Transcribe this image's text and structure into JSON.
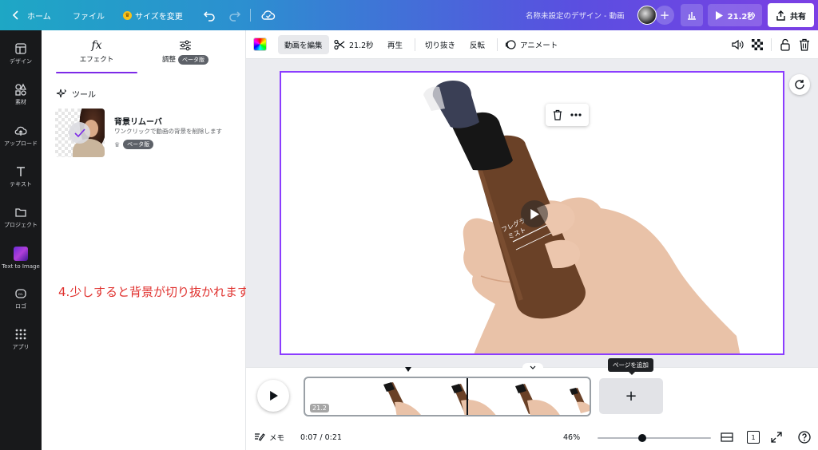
{
  "topbar": {
    "home_label": "ホーム",
    "file_label": "ファイル",
    "resize_label": "サイズを変更",
    "doc_title": "名称未設定のデザイン - 動画",
    "play_duration": "21.2秒",
    "share_label": "共有"
  },
  "rail": {
    "items": [
      {
        "label": "デザイン",
        "icon": "layout-icon"
      },
      {
        "label": "素材",
        "icon": "shapes-icon"
      },
      {
        "label": "アップロード",
        "icon": "cloud-upload-icon"
      },
      {
        "label": "テキスト",
        "icon": "text-icon"
      },
      {
        "label": "プロジェクト",
        "icon": "folder-icon"
      },
      {
        "label": "Text to Image",
        "icon": "ai-image-icon"
      },
      {
        "label": "ロゴ",
        "icon": "logo-icon"
      },
      {
        "label": "アプリ",
        "icon": "apps-grid-icon"
      }
    ]
  },
  "panel": {
    "tab_effects": "エフェクト",
    "tab_effects_icon": "fx",
    "tab_adjust": "調整",
    "tab_adjust_badge": "ベータ版",
    "tools_heading": "ツール",
    "bg_remover": {
      "title": "背景リムーバ",
      "description": "ワンクリックで動画の背景を削除します",
      "badge": "ベータ版"
    },
    "annotation": "4.少しすると背景が切り抜かれます"
  },
  "context_toolbar": {
    "edit_video": "動画を編集",
    "trim_duration": "21.2秒",
    "playback": "再生",
    "crop": "切り抜き",
    "flip": "反転",
    "animate": "アニメート"
  },
  "timeline": {
    "clip_duration": "21.2",
    "add_page_tooltip": "ページを追加",
    "add_page_symbol": "+"
  },
  "bottombar": {
    "notes_label": "メモ",
    "time": "0:07 / 0:21",
    "zoom": "46%",
    "page_count": "1"
  },
  "colors": {
    "accent": "#8b3dff",
    "annotation": "#e0322f",
    "rail_bg": "#18191b"
  }
}
